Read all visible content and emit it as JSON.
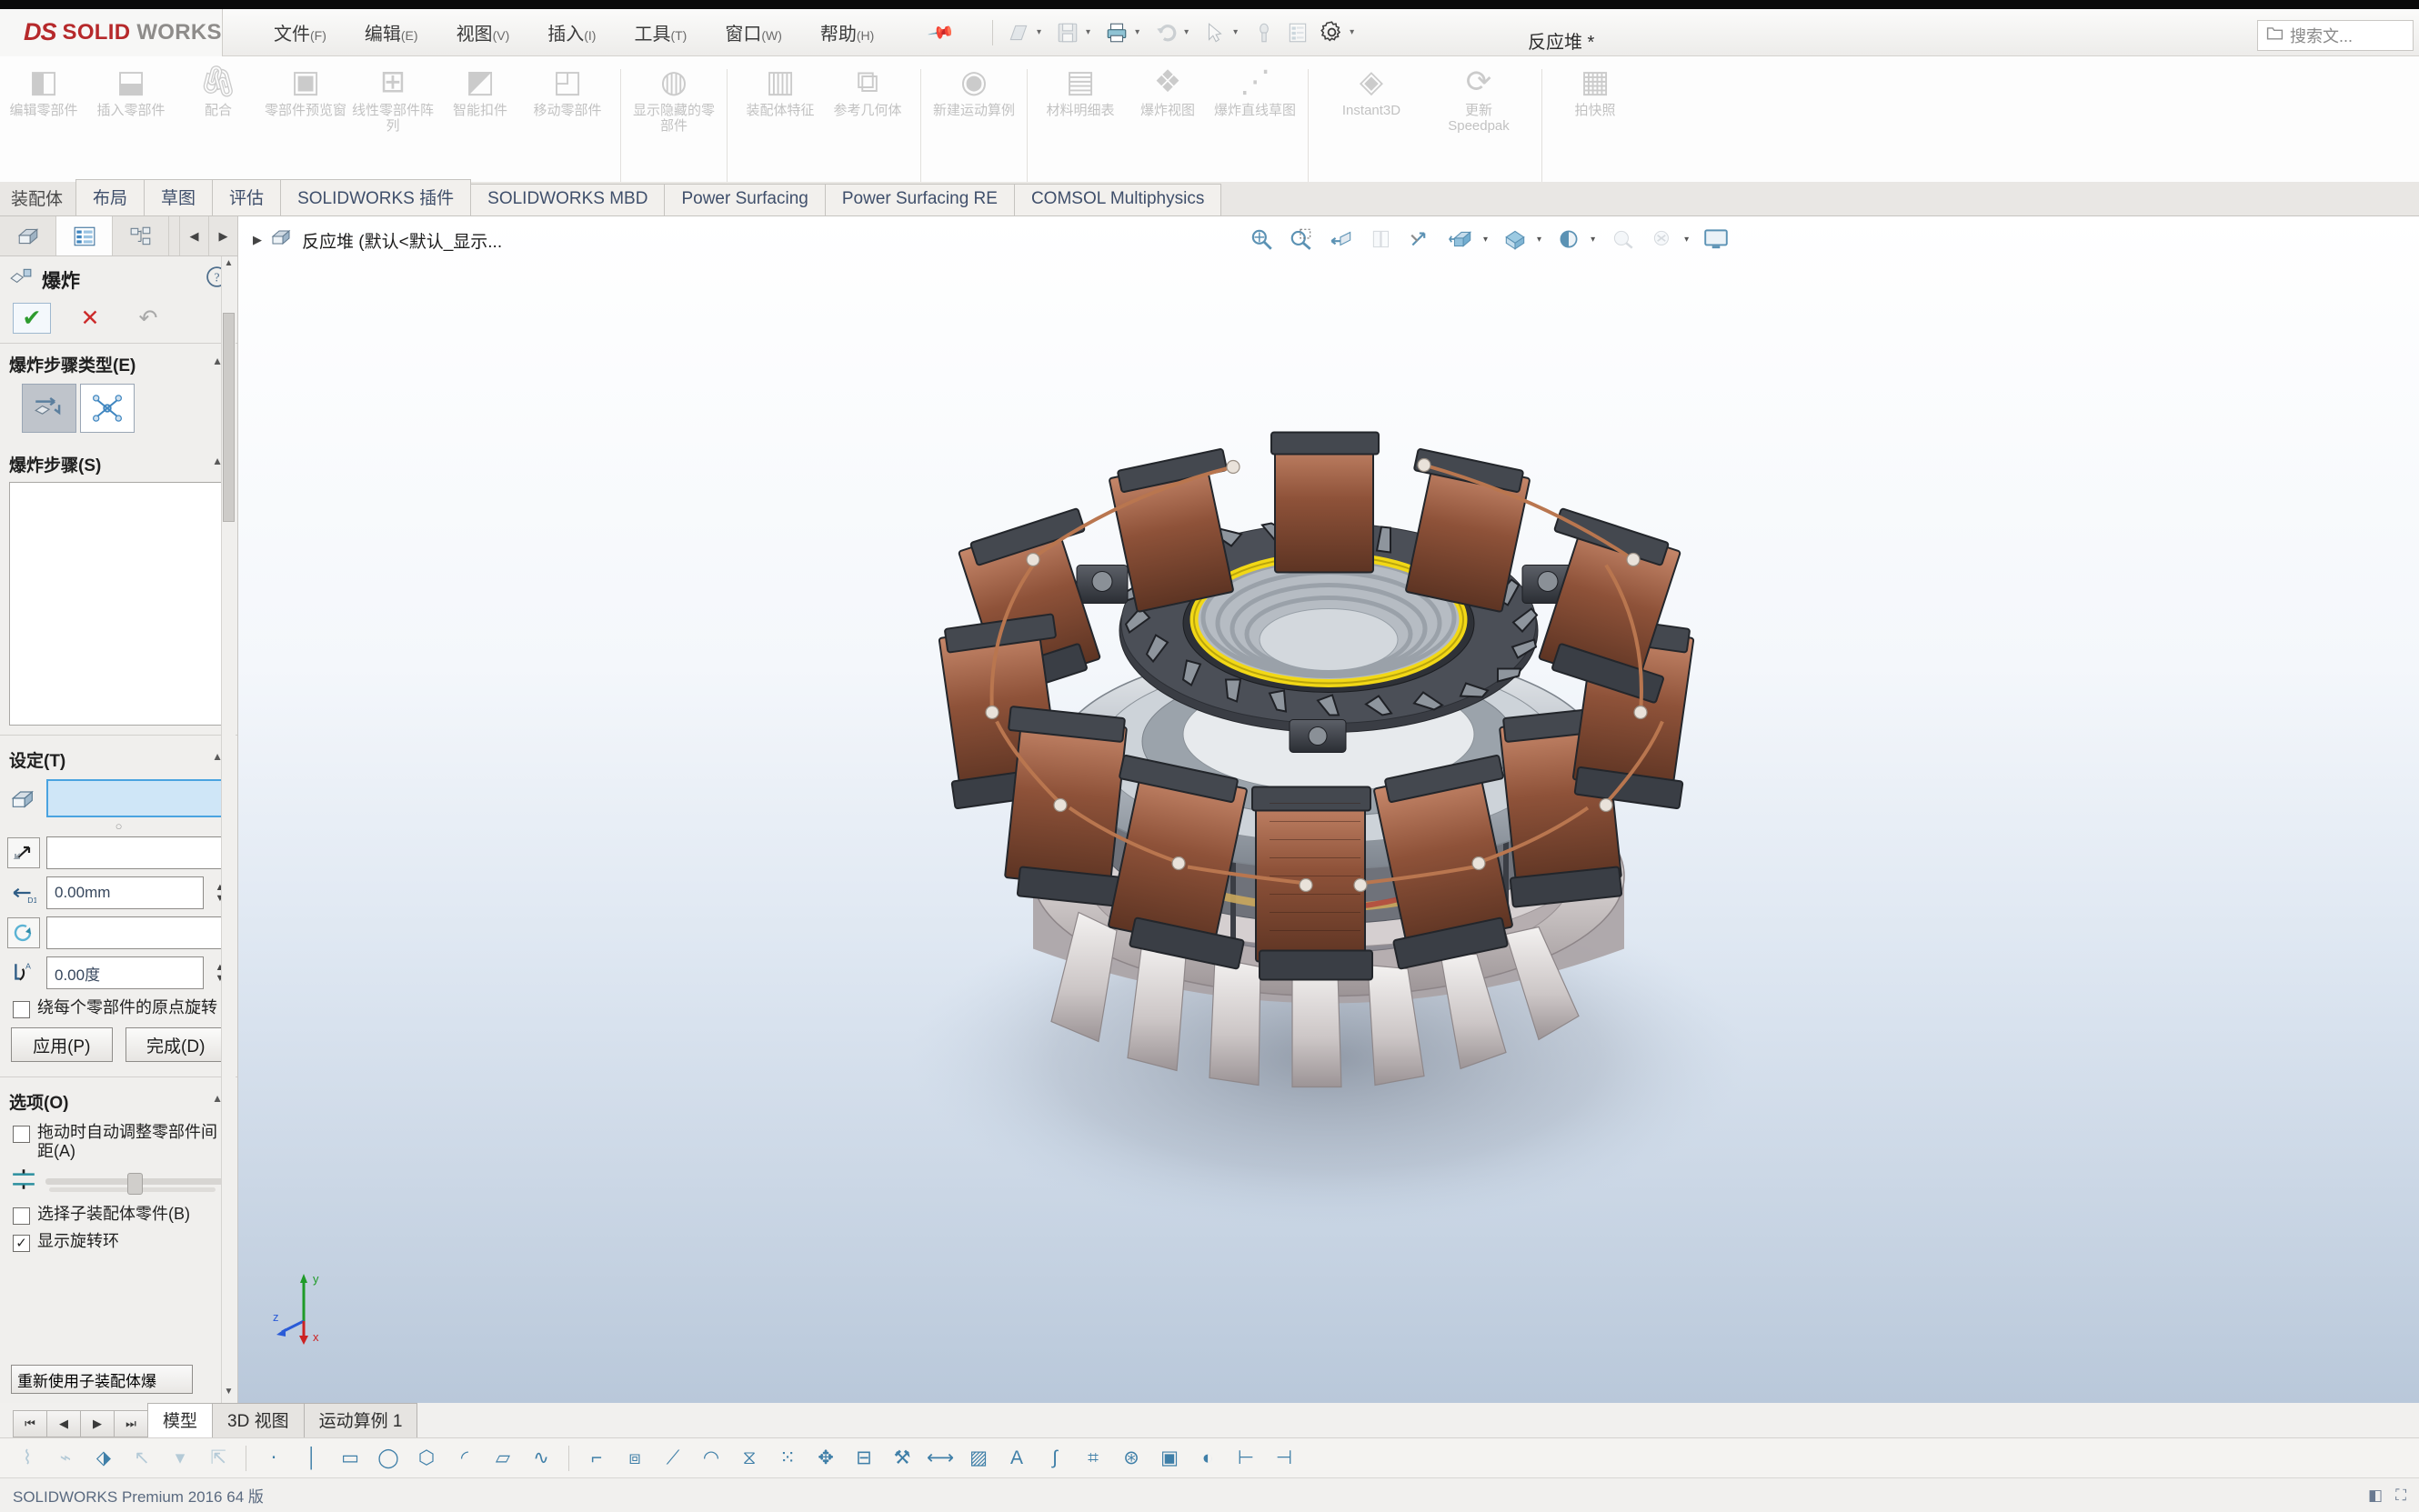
{
  "app": {
    "brand_ds": "DS",
    "brand_solid": "SOLID",
    "brand_works": "WORKS",
    "document_title": "反应堆 *",
    "version_text": "SOLIDWORKS Premium 2016  64 版"
  },
  "menus": [
    {
      "label": "文件",
      "key": "(F)"
    },
    {
      "label": "编辑",
      "key": "(E)"
    },
    {
      "label": "视图",
      "key": "(V)"
    },
    {
      "label": "插入",
      "key": "(I)"
    },
    {
      "label": "工具",
      "key": "(T)"
    },
    {
      "label": "窗口",
      "key": "(W)"
    },
    {
      "label": "帮助",
      "key": "(H)"
    }
  ],
  "quick_access": [
    {
      "icon": "new-document-icon",
      "caret": true
    },
    {
      "icon": "save-icon",
      "caret": true
    },
    {
      "icon": "print-icon",
      "caret": true
    },
    {
      "icon": "undo-icon",
      "caret": true
    },
    {
      "icon": "select-cursor-icon",
      "caret": true
    },
    {
      "icon": "rebuild-icon",
      "caret": false
    },
    {
      "icon": "file-properties-icon",
      "caret": false
    },
    {
      "icon": "options-gear-icon",
      "caret": true
    }
  ],
  "search": {
    "icon": "folder-search-icon",
    "placeholder": "搜索文..."
  },
  "ribbon": [
    {
      "label": "编辑零部件",
      "icon": "edit-component-icon"
    },
    {
      "label": "插入零部件",
      "icon": "insert-component-icon"
    },
    {
      "label": "配合",
      "icon": "mate-icon"
    },
    {
      "label": "零部件预览窗",
      "icon": "component-preview-icon"
    },
    {
      "label": "线性零部件阵列",
      "icon": "linear-pattern-icon"
    },
    {
      "label": "智能扣件",
      "icon": "smart-fastener-icon"
    },
    {
      "label": "移动零部件",
      "icon": "move-component-icon"
    },
    {
      "sep": true
    },
    {
      "label": "显示隐藏的零部件",
      "icon": "show-hidden-components-icon"
    },
    {
      "sep": true
    },
    {
      "label": "装配体特征",
      "icon": "assembly-feature-icon"
    },
    {
      "label": "参考几何体",
      "icon": "reference-geometry-icon"
    },
    {
      "sep": true
    },
    {
      "label": "新建运动算例",
      "icon": "new-motion-study-icon"
    },
    {
      "sep": true
    },
    {
      "label": "材料明细表",
      "icon": "bill-of-materials-icon"
    },
    {
      "label": "爆炸视图",
      "icon": "exploded-view-icon"
    },
    {
      "label": "爆炸直线草图",
      "icon": "explode-line-sketch-icon"
    },
    {
      "sep": true
    },
    {
      "label": "Instant3D",
      "icon": "instant3d-icon"
    },
    {
      "label": "更新 Speedpak",
      "icon": "update-speedpak-icon"
    },
    {
      "sep": true
    },
    {
      "label": "拍快照",
      "icon": "take-snapshot-icon"
    }
  ],
  "tabs": {
    "lead": "装配体",
    "items": [
      {
        "label": "布局",
        "active": false
      },
      {
        "label": "草图",
        "active": false
      },
      {
        "label": "评估",
        "active": false
      },
      {
        "label": "SOLIDWORKS 插件",
        "active": false
      },
      {
        "label": "SOLIDWORKS MBD",
        "active": false
      },
      {
        "label": "Power Surfacing",
        "active": false
      },
      {
        "label": "Power Surfacing RE",
        "active": false
      },
      {
        "label": "COMSOL Multiphysics",
        "active": false
      }
    ]
  },
  "property_manager": {
    "tabs": [
      {
        "icon": "feature-tree-icon",
        "selected": false
      },
      {
        "icon": "property-manager-icon",
        "selected": true
      },
      {
        "icon": "configuration-manager-icon",
        "selected": false
      }
    ],
    "nav_prev": "◀",
    "nav_next": "▶",
    "title": "爆炸",
    "title_icon": "explode-icon",
    "help_icon": "help-icon",
    "actions": {
      "ok": "✔",
      "cancel": "✕",
      "undo": "↶"
    },
    "sections": {
      "step_type": {
        "title": "爆炸步骤类型(E)",
        "options": [
          {
            "icon": "regular-step-icon",
            "selected": true
          },
          {
            "icon": "radial-step-icon",
            "selected": false
          }
        ]
      },
      "steps": {
        "title": "爆炸步骤(S)",
        "items": []
      },
      "settings": {
        "title": "设定(T)",
        "components_field": {
          "icon": "components-icon",
          "value": "",
          "selected": true
        },
        "direction_field": {
          "icon": "direction-icon",
          "value": ""
        },
        "distance_field": {
          "icon": "distance-d1-icon",
          "value": "0.00mm"
        },
        "rotation_axis_field": {
          "icon": "rotation-axis-icon",
          "value": ""
        },
        "angle_field": {
          "icon": "angle-icon",
          "value": "0.00度"
        },
        "rotate_about_origin": {
          "label": "绕每个零部件的原点旋转",
          "checked": false
        },
        "apply_button": "应用(P)",
        "done_button": "完成(D)"
      },
      "options": {
        "title": "选项(O)",
        "auto_space": {
          "label": "拖动时自动调整零部件间距(A)",
          "checked": false
        },
        "slider_icon": "spacing-slider-icon",
        "slider_value": 45,
        "select_subassembly": {
          "label": "选择子装配体零件(B)",
          "checked": false
        },
        "show_rotation_ring": {
          "label": "显示旋转环",
          "checked": true
        },
        "reuse_button": "重新使用子装配体爆"
      }
    }
  },
  "viewport": {
    "tree_root": {
      "expander": "▶",
      "icon": "assembly-icon",
      "label": "反应堆  (默认<默认_显示..."
    },
    "hud_tools": [
      {
        "icon": "zoom-to-fit-icon",
        "caret": false,
        "dim": false
      },
      {
        "icon": "zoom-to-area-icon",
        "caret": false,
        "dim": false
      },
      {
        "icon": "previous-view-icon",
        "caret": false,
        "dim": false
      },
      {
        "icon": "section-view-icon",
        "caret": false,
        "dim": true
      },
      {
        "icon": "view-orientation-icon",
        "caret": false,
        "dim": false
      },
      {
        "icon": "display-style-icon",
        "caret": true,
        "dim": false
      },
      {
        "icon": "hide-show-items-icon",
        "caret": true,
        "dim": false
      },
      {
        "icon": "edit-appearance-icon",
        "caret": true,
        "dim": false
      },
      {
        "icon": "apply-scene-icon",
        "caret": false,
        "dim": true
      },
      {
        "icon": "view-settings-icon",
        "caret": true,
        "dim": true
      },
      {
        "icon": "viewport-layout-icon",
        "caret": false,
        "dim": false
      }
    ],
    "triad": {
      "x": "x",
      "y": "y",
      "z": "z"
    }
  },
  "bottom": {
    "nav": [
      "⏮",
      "◀",
      "▶",
      "⏭"
    ],
    "tabs": [
      {
        "label": "模型",
        "active": true
      },
      {
        "label": "3D 视图",
        "active": false
      },
      {
        "label": "运动算例 1",
        "active": false
      }
    ]
  }
}
